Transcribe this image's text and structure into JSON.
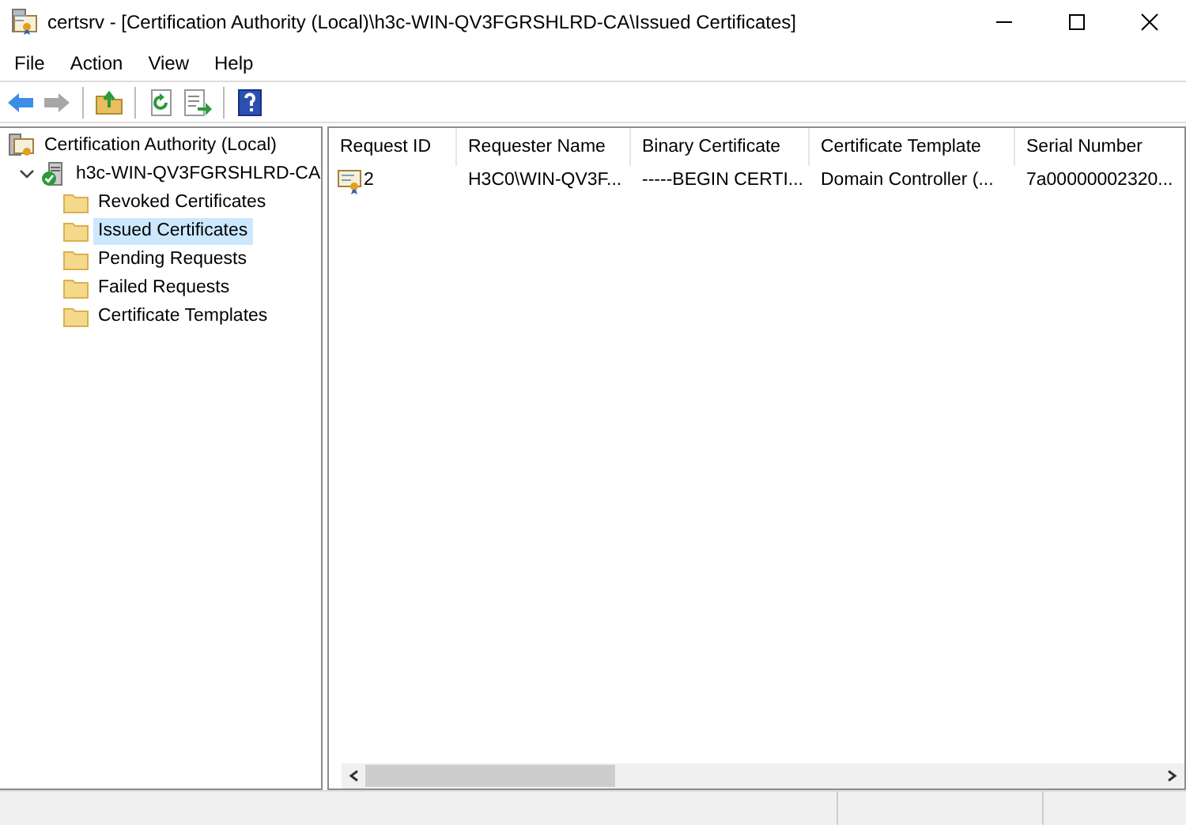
{
  "window": {
    "title": "certsrv - [Certification Authority (Local)\\h3c-WIN-QV3FGRSHLRD-CA\\Issued Certificates]"
  },
  "menu": [
    "File",
    "Action",
    "View",
    "Help"
  ],
  "toolbar": [
    {
      "kind": "back",
      "disabled": false
    },
    {
      "kind": "forward",
      "disabled": true
    },
    {
      "kind": "sep"
    },
    {
      "kind": "up",
      "disabled": false
    },
    {
      "kind": "sep"
    },
    {
      "kind": "refresh",
      "disabled": false
    },
    {
      "kind": "export",
      "disabled": false
    },
    {
      "kind": "sep"
    },
    {
      "kind": "help",
      "disabled": false
    }
  ],
  "tree": [
    {
      "label": "Certification Authority (Local)",
      "kind": "root",
      "selected": false,
      "children": [
        {
          "label": "h3c-WIN-QV3FGRSHLRD-CA",
          "kind": "server",
          "expanded": true,
          "selected": false,
          "children": [
            {
              "label": "Revoked Certificates",
              "kind": "folder",
              "selected": false
            },
            {
              "label": "Issued Certificates",
              "kind": "folder",
              "selected": true
            },
            {
              "label": "Pending Requests",
              "kind": "folder",
              "selected": false
            },
            {
              "label": "Failed Requests",
              "kind": "folder",
              "selected": false
            },
            {
              "label": "Certificate Templates",
              "kind": "folder",
              "selected": false
            }
          ]
        }
      ]
    }
  ],
  "table": {
    "columns": [
      "Request ID",
      "Requester Name",
      "Binary Certificate",
      "Certificate Template",
      "Serial Number"
    ],
    "rows": [
      [
        "2",
        "H3C0\\WIN-QV3F...",
        "-----BEGIN CERTI...",
        "Domain Controller (...",
        "7a00000002320..."
      ]
    ]
  }
}
